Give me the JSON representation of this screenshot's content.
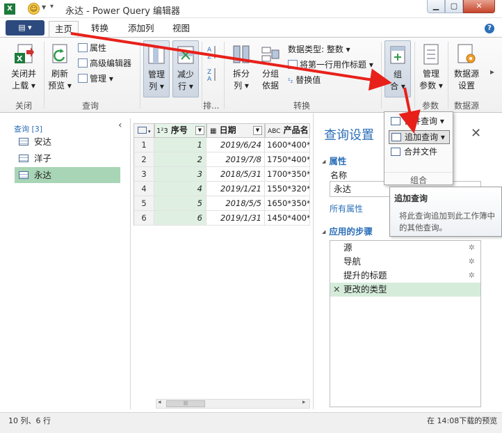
{
  "window": {
    "title": "永达 - Power Query 编辑器",
    "app_icon": "X",
    "min": "▁",
    "max": "▢",
    "close": "✕"
  },
  "quick_access": {
    "more": "▾"
  },
  "menu": {
    "file": "▤ ▾",
    "tabs": [
      "主页",
      "转换",
      "添加列",
      "视图"
    ],
    "active_tab": "主页",
    "help": "?"
  },
  "ribbon": {
    "close_load": [
      "关闭并",
      "上载 ▾"
    ],
    "close_group": "关闭",
    "refresh": [
      "刷新",
      "预览 ▾"
    ],
    "properties": "属性",
    "advanced_editor": "高级编辑器",
    "manage": "管理 ▾",
    "query_group": "查询",
    "manage_columns": [
      "管理",
      "列 ▾"
    ],
    "reduce_rows": [
      "减少",
      "行 ▾"
    ],
    "sort_group": "排...",
    "split_column": [
      "拆分",
      "列 ▾"
    ],
    "group_by": [
      "分组",
      "依据"
    ],
    "data_type": "数据类型: 整数 ▾",
    "first_row_header": "将第一行用作标题 ▾",
    "replace_values": "替换值",
    "transform_group": "转换",
    "combine": [
      "组",
      "合 ▾"
    ],
    "manage_params": [
      "管理",
      "参数 ▾"
    ],
    "params_group": "参数",
    "datasource_settings": [
      "数据源",
      "设置"
    ],
    "datasource_group": "数据源",
    "more": "▸"
  },
  "queries": {
    "header": "查询 [3]",
    "collapse": "‹",
    "items": [
      "安达",
      "洋子",
      "永达"
    ],
    "selected": "永达"
  },
  "grid": {
    "columns": [
      {
        "type": "1²3",
        "name": "序号"
      },
      {
        "type": "▦",
        "name": "日期"
      },
      {
        "type": "ABC",
        "name": "产品名"
      }
    ],
    "rows": [
      {
        "n": "1",
        "seq": "1",
        "date": "2019/6/24",
        "prod": "1600*400*"
      },
      {
        "n": "2",
        "seq": "2",
        "date": "2019/7/8",
        "prod": "1750*400*"
      },
      {
        "n": "3",
        "seq": "3",
        "date": "2018/5/31",
        "prod": "1700*350*"
      },
      {
        "n": "4",
        "seq": "4",
        "date": "2019/1/21",
        "prod": "1550*320*"
      },
      {
        "n": "5",
        "seq": "5",
        "date": "2018/5/5",
        "prod": "1650*350*"
      },
      {
        "n": "6",
        "seq": "6",
        "date": "2019/1/31",
        "prod": "1450*400*"
      }
    ],
    "scroll_left": "◂",
    "scroll_right": "▸",
    "thumb": "|||"
  },
  "settings": {
    "title": "查询设置",
    "close": "✕",
    "properties": "属性",
    "name_label": "名称",
    "name_value": "永达",
    "all_properties": "所有属性",
    "applied_steps": "应用的步骤",
    "steps": [
      "源",
      "导航",
      "提升的标题",
      "更改的类型"
    ],
    "selected_step": "更改的类型",
    "step_gear": "✲",
    "step_delete": "✕"
  },
  "combine_menu": {
    "items": [
      "合并查询 ▾",
      "追加查询 ▾",
      "合并文件"
    ],
    "highlighted": "追加查询",
    "group": "组合"
  },
  "tooltip": {
    "title": "追加查询",
    "text": "将此查询追加到此工作簿中的其他查询。"
  },
  "status": {
    "left": "10 列、6 行",
    "right": "在 14:08下载的预览"
  },
  "colors": {
    "accent": "#2c6fb8",
    "selection": "#a8d5b5",
    "annotation": "#e8201a"
  }
}
